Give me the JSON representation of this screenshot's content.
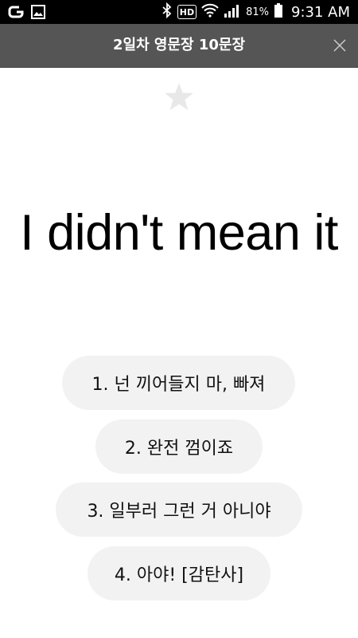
{
  "status_bar": {
    "battery_percent": "81%",
    "time": "9:31 AM",
    "hd_label": "HD"
  },
  "header": {
    "title": "2일차 영문장 10문장"
  },
  "sentence": "I didn't mean it",
  "options": [
    {
      "label": "1. 넌 끼어들지 마, 빠져"
    },
    {
      "label": "2. 완전 껌이죠"
    },
    {
      "label": "3. 일부러 그런 거 아니야"
    },
    {
      "label": "4. 아야! [감탄사]"
    }
  ],
  "colors": {
    "header_bg": "#555555",
    "status_bg": "#000000",
    "option_bg": "#f2f2f2",
    "star": "#e8e8e8"
  },
  "icons": [
    "app-notification-icon",
    "gallery-icon",
    "bluetooth-icon",
    "hd-voice-icon",
    "wifi-icon",
    "signal-icon",
    "battery-icon",
    "close-icon",
    "star-icon"
  ]
}
